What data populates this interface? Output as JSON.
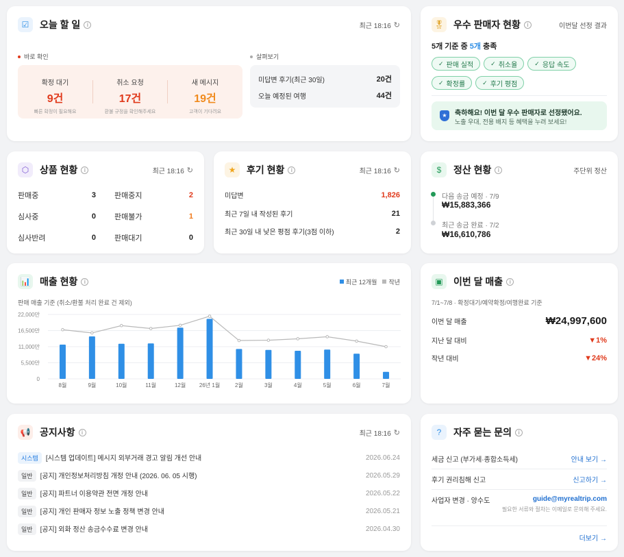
{
  "today": {
    "title": "오늘 할 일",
    "time": "최근 18:16",
    "urgent_label": "바로 확인",
    "urgent": [
      {
        "label": "확정 대기",
        "value": "9건",
        "sub": "빠른 확정이 필요해요"
      },
      {
        "label": "취소 요청",
        "value": "17건",
        "sub": "환불 규정을 확인해주세요"
      },
      {
        "label": "새 메시지",
        "value": "19건",
        "sub": "고객이 기다려요"
      }
    ],
    "review_label": "살펴보기",
    "review": [
      {
        "label": "미답변 후기(최근 30일)",
        "value": "20건"
      },
      {
        "label": "오늘 예정된 여행",
        "value": "44건"
      }
    ]
  },
  "seller": {
    "title": "우수 판매자 현황",
    "right": "이번달 선정 결과",
    "summary_pre": "5개 기준 중 ",
    "summary_hl": "5개",
    "summary_post": " 충족",
    "chips": [
      "판매 실적",
      "취소율",
      "응답 속도",
      "확정률",
      "후기 평점"
    ],
    "banner_title": "축하해요! 이번 달 우수 판매자로 선정됐어요.",
    "banner_sub": "노출 우대, 전용 배지 등 혜택을 누려 보세요!"
  },
  "product": {
    "title": "상품 현황",
    "time": "최근 18:16",
    "left": [
      {
        "label": "판매중",
        "value": "3"
      },
      {
        "label": "심사중",
        "value": "0"
      },
      {
        "label": "심사반려",
        "value": "0"
      }
    ],
    "right": [
      {
        "label": "판매중지",
        "value": "2"
      },
      {
        "label": "판매불가",
        "value": "1"
      },
      {
        "label": "판매대기",
        "value": "0"
      }
    ]
  },
  "reviews": {
    "title": "후기 현황",
    "time": "최근 18:16",
    "rows": [
      {
        "label": "미답변",
        "value": "1,826"
      },
      {
        "label": "최근 7일 내 작성된 후기",
        "value": "21"
      },
      {
        "label": "최근 30일 내 낮은 평점 후기(3점 이하)",
        "value": "2"
      }
    ]
  },
  "settlement": {
    "title": "정산 현황",
    "right": "주단위 정산",
    "items": [
      {
        "label": "다음 송금 예정 · 7/9",
        "value": "₩15,883,366"
      },
      {
        "label": "최근 송금 완료 · 7/2",
        "value": "₩16,610,786"
      }
    ]
  },
  "sales": {
    "title": "매출 현황",
    "subtitle": "판매 매출 기준 (취소/환불 처리 완료 건 제외)",
    "legend_bar": "최근 12개월",
    "legend_line": "작년",
    "colors": {
      "bar": "#2f8fe6",
      "line": "#b8b8b8"
    }
  },
  "chart_data": {
    "type": "bar",
    "categories": [
      "8월",
      "9월",
      "10월",
      "11월",
      "12월",
      "26년 1월",
      "2월",
      "3월",
      "4월",
      "5월",
      "6월",
      "7월"
    ],
    "series": [
      {
        "name": "최근 12개월",
        "type": "bar",
        "values": [
          11700,
          14500,
          12000,
          12100,
          17500,
          20500,
          10200,
          9900,
          9600,
          10000,
          8600,
          2400
        ]
      },
      {
        "name": "작년",
        "type": "line",
        "values": [
          16800,
          15700,
          18200,
          17200,
          18300,
          21400,
          13100,
          13200,
          13700,
          14400,
          12900,
          11000
        ]
      }
    ],
    "yticks": [
      "0",
      "5,500만",
      "11,000만",
      "16,500만",
      "22,000만"
    ],
    "ylim": [
      0,
      22000
    ]
  },
  "month": {
    "title": "이번 달 매출",
    "period": "7/1~7/8 · 확정대기/예약확정/여행완료 기준",
    "rows": [
      {
        "label": "이번 달 매출",
        "value": "₩24,997,600"
      },
      {
        "label": "지난 달 대비",
        "value": "▼1%"
      },
      {
        "label": "작년 대비",
        "value": "▼24%"
      }
    ]
  },
  "notice": {
    "title": "공지사항",
    "time": "최근 18:16",
    "items": [
      {
        "tag": "시스템",
        "text": "[시스템 업데이트] 메시지 외부거래 경고 알림 개선 안내",
        "date": "2026.06.24"
      },
      {
        "tag": "일반",
        "text": "[공지] 개인정보처리방침 개정 안내 (2026. 06. 05 시행)",
        "date": "2026.05.29"
      },
      {
        "tag": "일반",
        "text": "[공지] 파트너 이용약관 전면 개정 안내",
        "date": "2026.05.22"
      },
      {
        "tag": "일반",
        "text": "[공지] 개인 판매자 정보 노출 정책 변경 안내",
        "date": "2026.05.21"
      },
      {
        "tag": "일반",
        "text": "[공지] 외화 정산 송금수수료 변경 안내",
        "date": "2026.04.30"
      }
    ]
  },
  "faq": {
    "title": "자주 묻는 문의",
    "items": [
      {
        "label": "세금 신고 (부가세·종합소득세)",
        "link": "안내 보기 →"
      },
      {
        "label": "후기 권리침해 신고",
        "link": "신고하기 →"
      }
    ],
    "contact_label": "사업자 변경 · 양수도",
    "contact_email": "guide@myrealtrip.com",
    "contact_sub": "필요한 서류와 절차는 이메일로 문의해 주세요.",
    "more": "더보기 →"
  }
}
